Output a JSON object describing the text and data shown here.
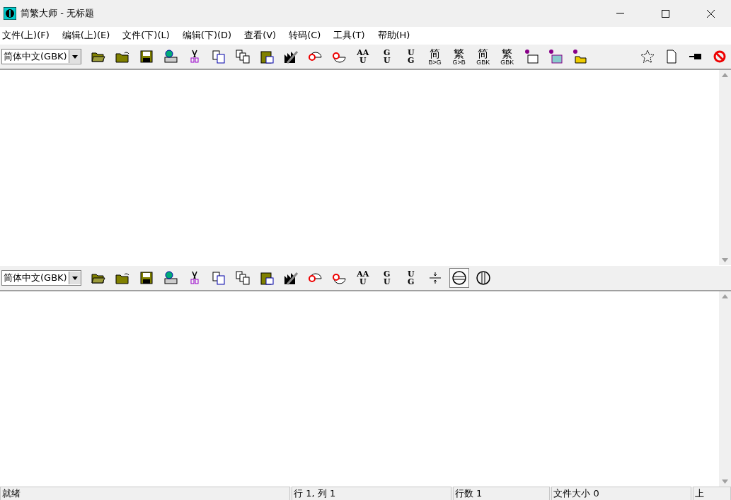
{
  "window": {
    "title": "简繁大师 - 无标题"
  },
  "menu": [
    "文件(上)(F)",
    "编辑(上)(E)",
    "文件(下)(L)",
    "编辑(下)(D)",
    "查看(V)",
    "转码(C)",
    "工具(T)",
    "帮助(H)"
  ],
  "top_toolbar": {
    "encoding": "简体中文(GBK)",
    "converters": [
      {
        "top": "AA",
        "bottom": "U"
      },
      {
        "top": "G",
        "bottom": "U"
      },
      {
        "top": "U",
        "bottom": "G"
      }
    ],
    "char_buttons": [
      {
        "char": "简",
        "sub": "B>G"
      },
      {
        "char": "繁",
        "sub": "G>B"
      },
      {
        "char": "简",
        "sub": "GBK"
      },
      {
        "char": "繁",
        "sub": "GBK"
      }
    ]
  },
  "bottom_toolbar": {
    "encoding": "简体中文(GBK)",
    "converters": [
      {
        "top": "AA",
        "bottom": "U"
      },
      {
        "top": "G",
        "bottom": "U"
      },
      {
        "top": "U",
        "bottom": "G"
      }
    ],
    "split_buttons": [
      {
        "selected": false
      },
      {
        "selected": true
      },
      {
        "selected": false
      }
    ]
  },
  "status_bar": [
    "就绪",
    "行 1, 列 1",
    "行数 1",
    "文件大小 0",
    "上"
  ]
}
